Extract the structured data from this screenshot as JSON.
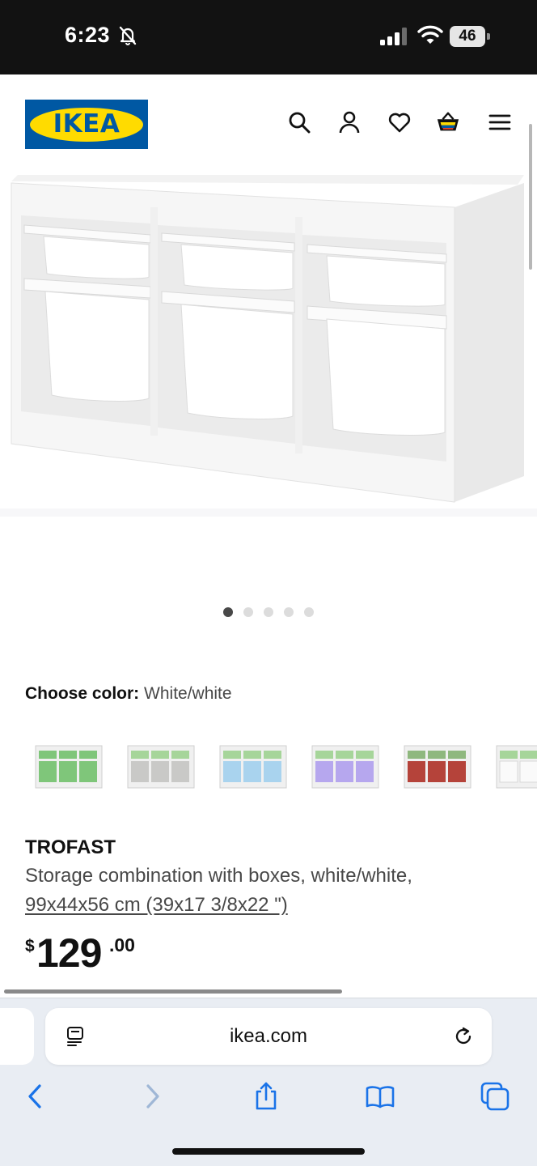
{
  "status_bar": {
    "time": "6:23",
    "battery_level": "46",
    "icons": [
      "bell-slash-icon",
      "signal-icon",
      "wifi-icon",
      "battery-icon"
    ]
  },
  "header": {
    "logo_text": "IKEA",
    "icons": [
      "search-icon",
      "account-icon",
      "heart-icon",
      "basket-icon",
      "menu-icon"
    ],
    "brand_colors": {
      "blue": "#0058a3",
      "yellow": "#ffdb00"
    }
  },
  "gallery": {
    "image_count": 5,
    "active_index": 0
  },
  "color_selector": {
    "label": "Choose color:",
    "selected": "White/white",
    "swatch_box_colors": [
      "#7fc67a",
      "#c9c9c7",
      "#a9d3ee",
      "#b6a7ee",
      "#b5433a",
      "#eaeaea"
    ]
  },
  "product": {
    "name": "TROFAST",
    "description": "Storage combination with boxes, white/white,",
    "dimensions": "99x44x56 cm (39x17 3/8x22 \")",
    "price": {
      "currency": "$",
      "integer": "129",
      "decimal": ".00"
    }
  },
  "browser": {
    "url": "ikea.com",
    "icons": [
      "reader-icon",
      "reload-icon",
      "back-icon",
      "forward-icon",
      "share-icon",
      "bookmarks-icon",
      "tabs-icon"
    ]
  }
}
